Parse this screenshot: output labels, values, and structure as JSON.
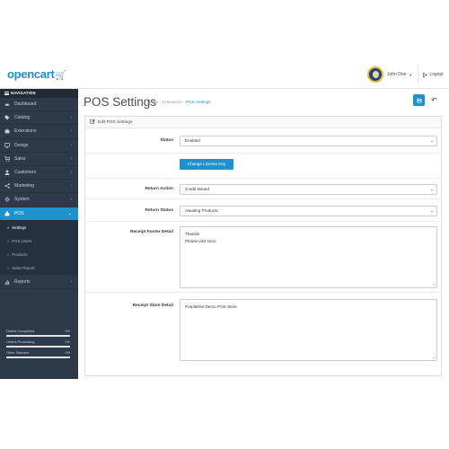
{
  "header": {
    "logo_text": "opencart",
    "logo_cart_glyph": "🛒",
    "user_name": "John Doe",
    "logout_label": "Logout"
  },
  "sidebar": {
    "nav_title": "NAVIGATION",
    "items": [
      {
        "label": "Dashboard",
        "icon": "dashboard-icon"
      },
      {
        "label": "Catalog",
        "icon": "tag-icon"
      },
      {
        "label": "Extensions",
        "icon": "puzzle-icon"
      },
      {
        "label": "Design",
        "icon": "monitor-icon"
      },
      {
        "label": "Sales",
        "icon": "cart-icon"
      },
      {
        "label": "Customers",
        "icon": "user-icon"
      },
      {
        "label": "Marketing",
        "icon": "share-icon"
      },
      {
        "label": "System",
        "icon": "gear-icon"
      },
      {
        "label": "POS",
        "icon": "register-icon"
      }
    ],
    "pos_sub": [
      "Settings",
      "POS Users",
      "Products",
      "Sales Report"
    ],
    "reports_label": "Reports",
    "stats": [
      {
        "label": "Orders Completed",
        "value": "0%",
        "progress": 1.0
      },
      {
        "label": "Orders Processing",
        "value": "0%",
        "progress": 1.0
      },
      {
        "label": "Other Statuses",
        "value": "0%",
        "progress": 1.0
      }
    ]
  },
  "page": {
    "title": "POS Settings",
    "breadcrumb": [
      "Home",
      "Extensions",
      "POS Settings"
    ],
    "breadcrumb_sep": "›",
    "panel_title": "Edit POS Settings"
  },
  "form": {
    "status_label": "Status",
    "status_value": "Enabled",
    "license_button": "Change License Key",
    "return_action_label": "Return Action",
    "return_action_value": "Credit Issued",
    "return_status_label": "Return Status",
    "return_status_value": "Awaiting Products",
    "footer_label": "Receipt Footer Detail",
    "footer_lines": [
      "Thanks!",
      "Please visit soon."
    ],
    "store_label": "Receipt Store Detail",
    "store_lines": [
      "Purpletree Demo POS Store"
    ]
  },
  "colors": {
    "accent": "#1e91cf",
    "sidebar_bg": "#2c3a49",
    "nav_header_bg": "#202b37"
  }
}
